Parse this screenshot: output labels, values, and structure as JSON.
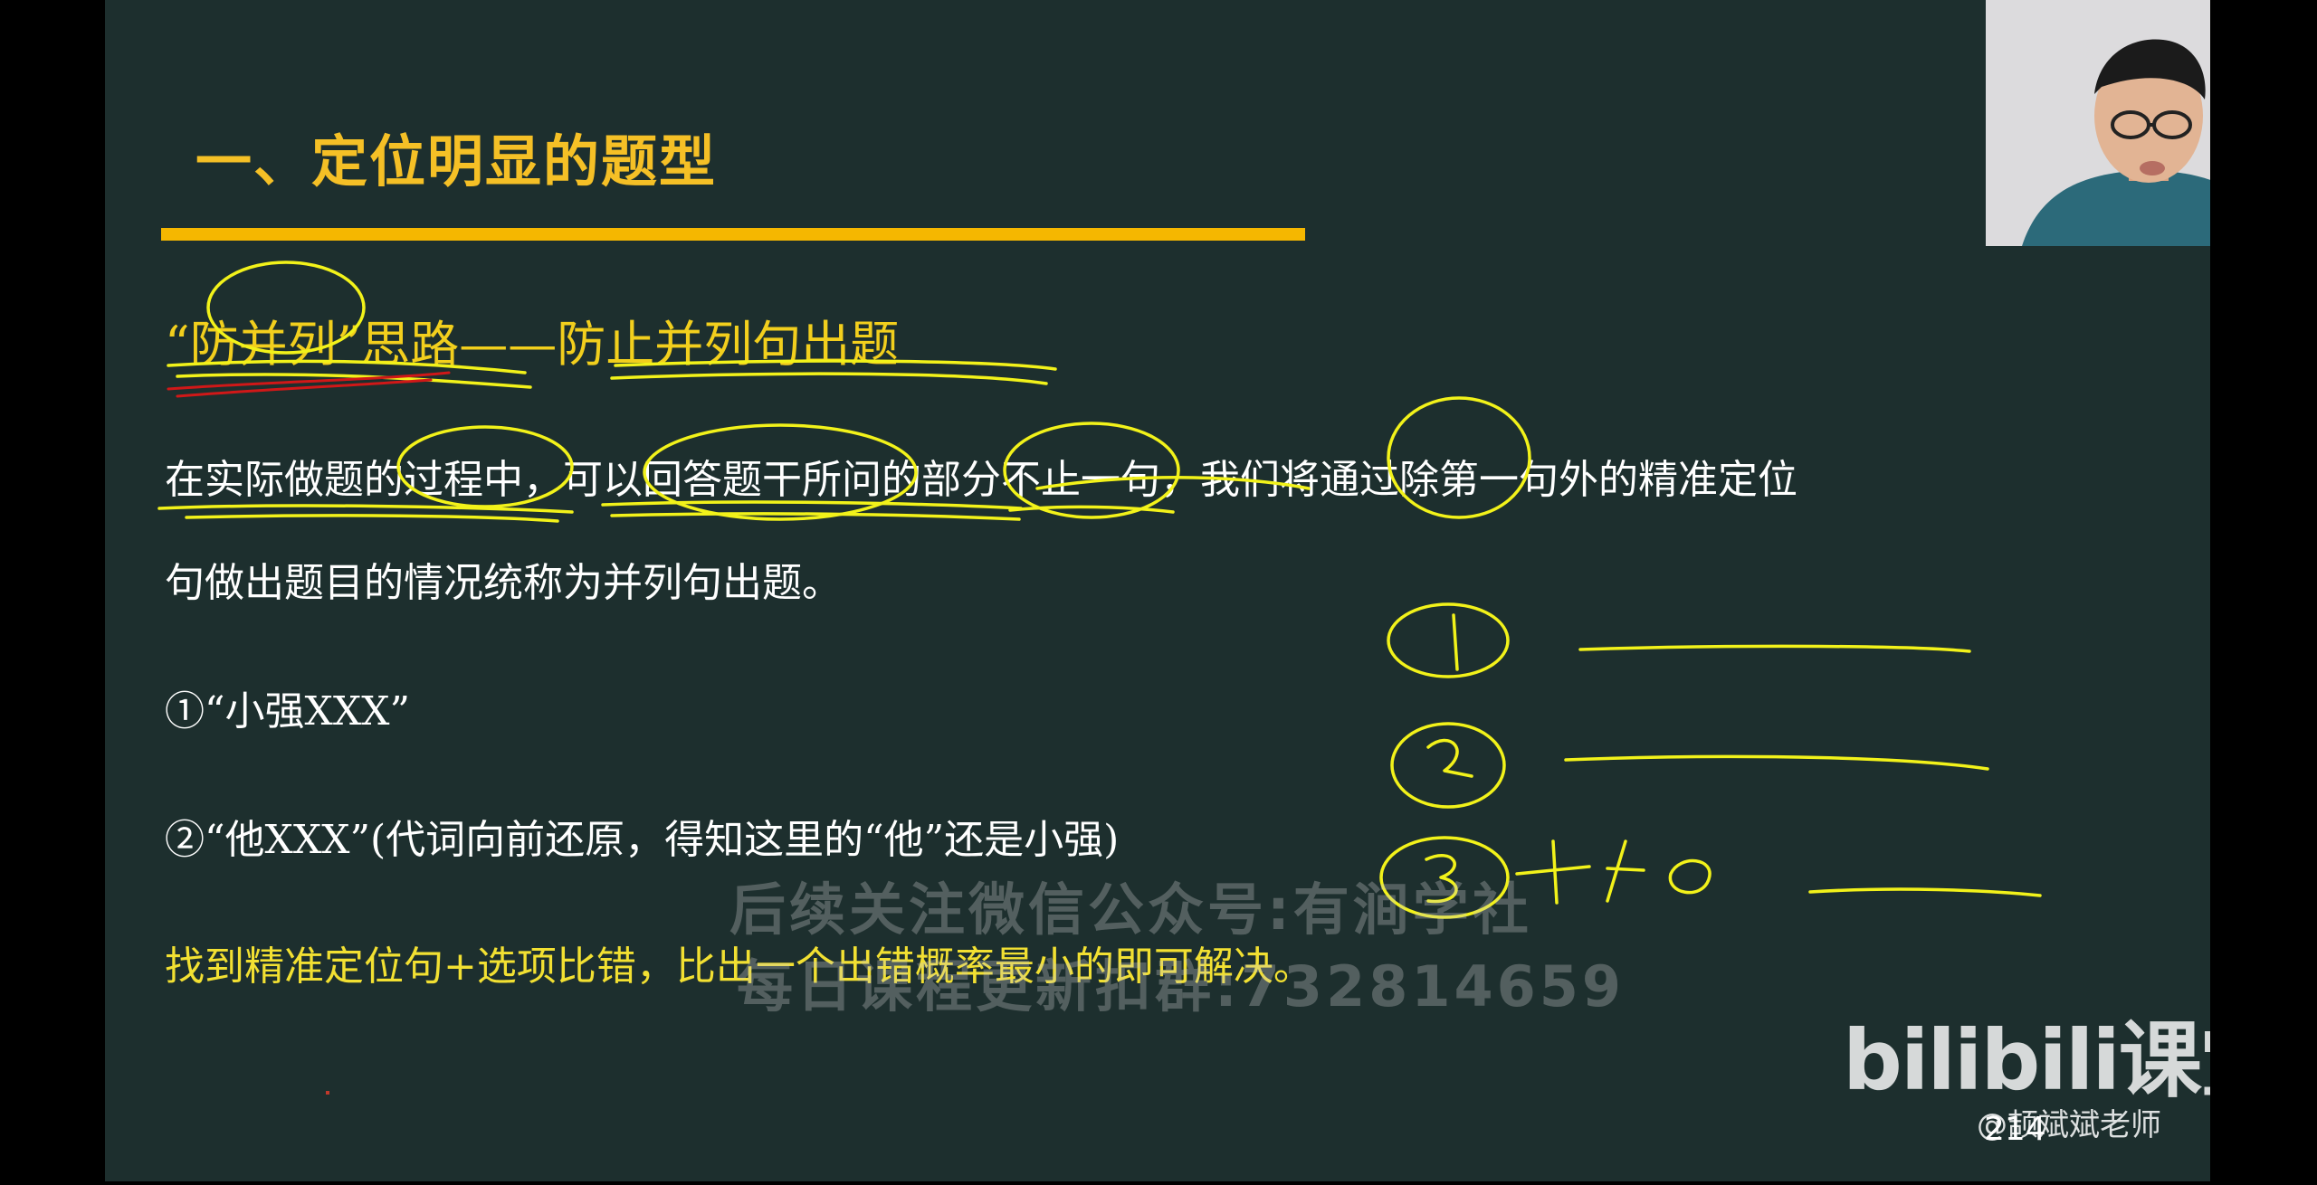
{
  "slide": {
    "heading": "一、定位明显的题型",
    "subtitle": "“防并列”思路——防止并列句出题",
    "paragraph_line1": "在实际做题的过程中，可以回答题干所问的部分不止一句，我们将通过除第一句外的精准定位",
    "paragraph_line2": "句做出题目的情况统称为并列句出题。",
    "example1": "①“小强XXX”",
    "example2": "②“他XXX”(代词向前还原，得知这里的“他”还是小强)",
    "conclusion": "找到精准定位句+选项比错，比出一个出错概率最小的即可解决。",
    "page_number": "214",
    "ink_annotation": "+40"
  },
  "overlay": {
    "watermark_line1": "后续关注微信公众号:有涧学社",
    "watermark_line2": "每日课程更新扣群:732814659",
    "logo_text": "bilibili课堂",
    "author": "@颉斌斌老师"
  },
  "colors": {
    "background": "#1d2f2e",
    "heading": "#f5c026",
    "rule": "#f5b700",
    "subtitle": "#f2cf1d",
    "body": "#ffffff",
    "conclusion": "#f2e032",
    "ink": "#f2f21a"
  }
}
